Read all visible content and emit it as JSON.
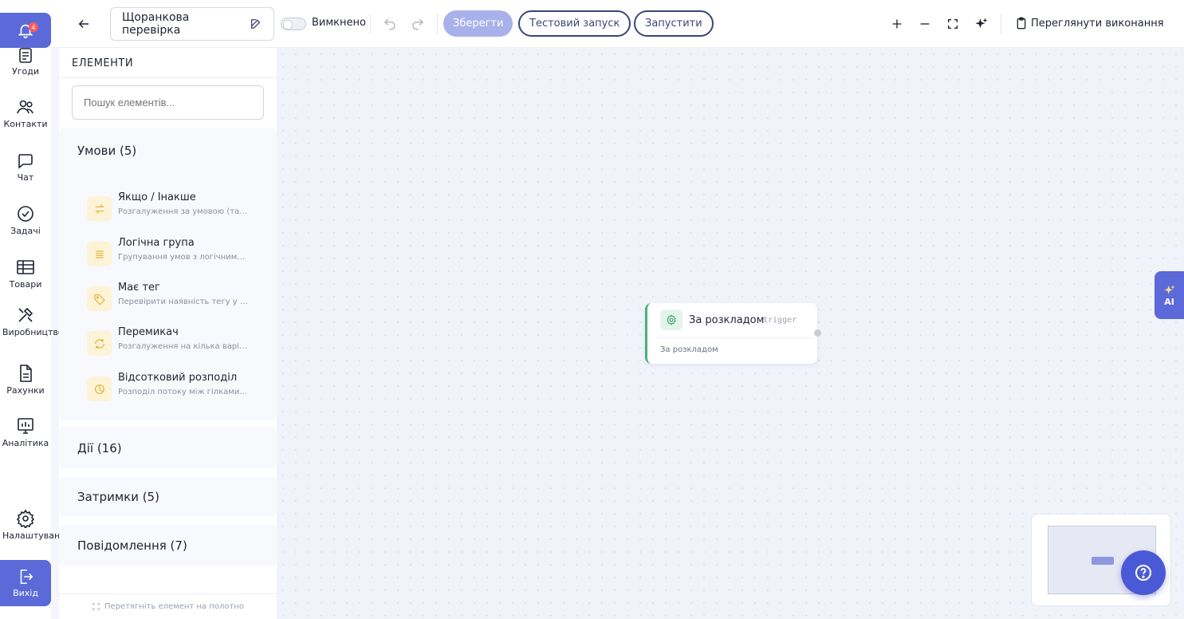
{
  "rail": {
    "notification_count": "4",
    "items": [
      {
        "label": "Угоди",
        "icon": "deals-icon"
      },
      {
        "label": "Контакти",
        "icon": "contacts-icon"
      },
      {
        "label": "Чат",
        "icon": "chat-icon"
      },
      {
        "label": "Задачі",
        "icon": "tasks-icon"
      },
      {
        "label": "Товари",
        "icon": "products-icon"
      },
      {
        "label": "Виробництво",
        "icon": "production-icon"
      },
      {
        "label": "Рахунки",
        "icon": "invoices-icon"
      },
      {
        "label": "Аналітика",
        "icon": "analytics-icon"
      },
      {
        "label": "Налаштування",
        "icon": "settings-icon"
      },
      {
        "label": "Вихід",
        "icon": "logout-icon"
      }
    ]
  },
  "toolbar": {
    "workflow_name": "Щоранкова перевірка",
    "status_label": "Вимкнено",
    "save_label": "Зберегти",
    "test_run_label": "Тестовий запуск",
    "run_label": "Запустити",
    "view_executions_label": "Переглянути виконання"
  },
  "panel": {
    "title": "ЕЛЕМЕНТИ",
    "search_placeholder": "Пошук елементів...",
    "groups": [
      {
        "title": "Умови (5)",
        "expanded": true
      },
      {
        "title": "Дії (16)"
      },
      {
        "title": "Затримки (5)"
      },
      {
        "title": "Повідомлення (7)"
      }
    ],
    "conditions": [
      {
        "name": "Якщо / Інакше",
        "desc": "Розгалуження за умовою (так/ні)",
        "icon": "branch-icon"
      },
      {
        "name": "Логічна група",
        "desc": "Групування умов з логічними операторами",
        "icon": "logic-group-icon"
      },
      {
        "name": "Має тег",
        "desc": "Перевірити наявність тегу у сутності",
        "icon": "tag-icon"
      },
      {
        "name": "Перемикач",
        "desc": "Розгалуження на кілька варіантів",
        "icon": "switch-icon"
      },
      {
        "name": "Відсотковий розподіл",
        "desc": "Розподіл потоку між гілками у відсотках",
        "icon": "split-icon"
      }
    ],
    "footer_hint": "Перетягніть елемент на полотно"
  },
  "canvas": {
    "node": {
      "title": "За розкладом",
      "type_tag": "trigger",
      "subtitle": "За розкладом",
      "accent_color": "#4caf7a"
    },
    "ai_label": "AI"
  },
  "colors": {
    "primary": "#5b6ad8",
    "dark_outline": "#3c4577"
  }
}
